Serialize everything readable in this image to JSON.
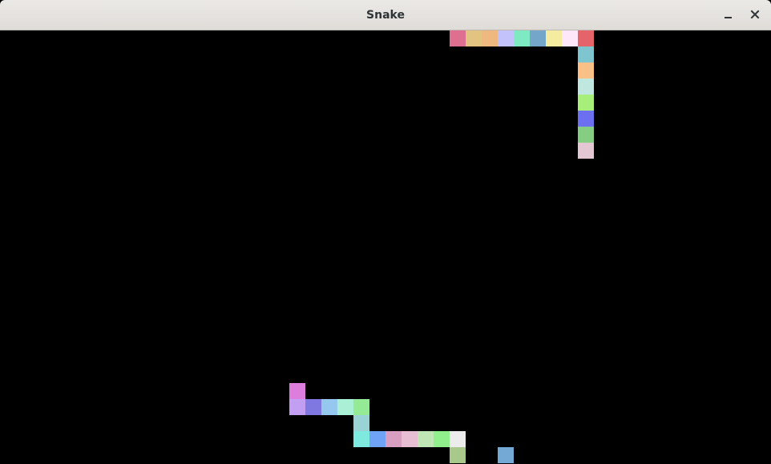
{
  "window": {
    "title": "Snake",
    "buttons": [
      {
        "name": "minimize",
        "icon": "minimize-icon"
      },
      {
        "name": "close",
        "icon": "close-icon"
      }
    ]
  },
  "board": {
    "background": "#000000",
    "grid_cell_units": "cells",
    "snakes": [
      {
        "cells": [
          {
            "col": 28,
            "row": 0,
            "color": "#de6f91"
          },
          {
            "col": 29,
            "row": 0,
            "color": "#e2c37f"
          },
          {
            "col": 30,
            "row": 0,
            "color": "#efb880"
          },
          {
            "col": 31,
            "row": 0,
            "color": "#c3c2fb"
          },
          {
            "col": 32,
            "row": 0,
            "color": "#7eeac1"
          },
          {
            "col": 33,
            "row": 0,
            "color": "#73a6c9"
          },
          {
            "col": 34,
            "row": 0,
            "color": "#f6ec9f"
          },
          {
            "col": 35,
            "row": 0,
            "color": "#fde7f8"
          },
          {
            "col": 36,
            "row": 0,
            "color": "#e46469"
          },
          {
            "col": 36,
            "row": 1,
            "color": "#7ec5d0"
          },
          {
            "col": 36,
            "row": 2,
            "color": "#f9c088"
          },
          {
            "col": 36,
            "row": 3,
            "color": "#c0e7df"
          },
          {
            "col": 36,
            "row": 4,
            "color": "#a7ee7a"
          },
          {
            "col": 36,
            "row": 5,
            "color": "#6b6ff0"
          },
          {
            "col": 36,
            "row": 6,
            "color": "#84cd83"
          },
          {
            "col": 36,
            "row": 7,
            "color": "#e3c7d2"
          }
        ]
      },
      {
        "cells": [
          {
            "col": 18,
            "row": 22,
            "color": "#dd7dde"
          },
          {
            "col": 18,
            "row": 23,
            "color": "#c39ff3"
          },
          {
            "col": 19,
            "row": 23,
            "color": "#7f78e0"
          },
          {
            "col": 20,
            "row": 23,
            "color": "#95c7ef"
          },
          {
            "col": 21,
            "row": 23,
            "color": "#a9f0d6"
          },
          {
            "col": 22,
            "row": 23,
            "color": "#94ea95"
          },
          {
            "col": 22,
            "row": 24,
            "color": "#9ad3d6"
          },
          {
            "col": 22,
            "row": 25,
            "color": "#7eeadf"
          },
          {
            "col": 23,
            "row": 25,
            "color": "#6ea3f6"
          },
          {
            "col": 24,
            "row": 25,
            "color": "#d89fc0"
          },
          {
            "col": 25,
            "row": 25,
            "color": "#e8bed3"
          },
          {
            "col": 26,
            "row": 25,
            "color": "#bfe6b4"
          },
          {
            "col": 27,
            "row": 25,
            "color": "#91f08b"
          },
          {
            "col": 28,
            "row": 25,
            "color": "#ececec"
          },
          {
            "col": 28,
            "row": 26,
            "color": "#a9c88b"
          }
        ]
      }
    ],
    "food": [
      {
        "col": 31,
        "row": 26,
        "color": "#74a9d6"
      }
    ]
  }
}
